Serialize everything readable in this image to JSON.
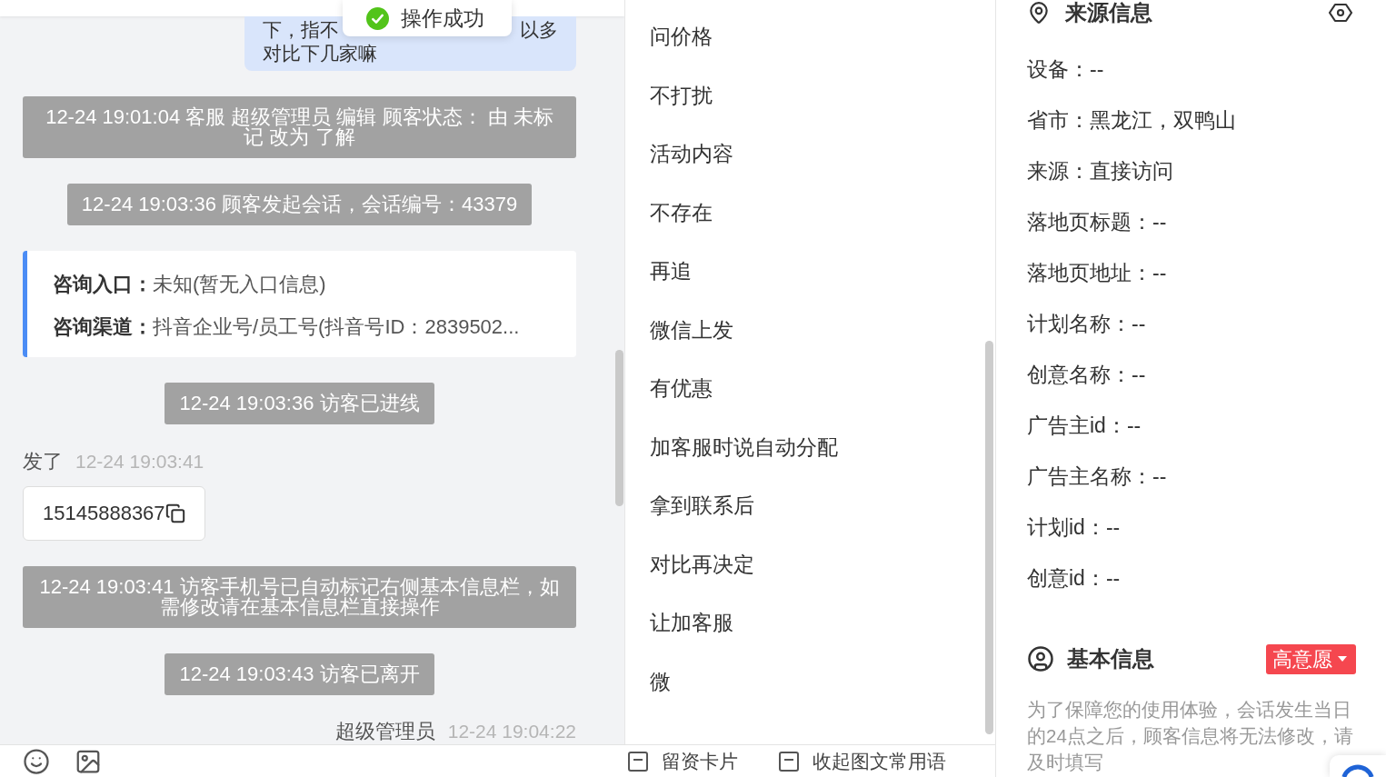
{
  "toast": {
    "text": "操作成功"
  },
  "chat": {
    "messages": [
      {
        "kind": "bubble",
        "covered_line": {
          "start": "下，指不",
          "end": "以多"
        },
        "last_line": "对比下几家嘛"
      },
      {
        "kind": "system",
        "text": "12-24 19:01:04 客服 超级管理员 编辑 顾客状态： 由 未标记 改为 了解"
      },
      {
        "kind": "system",
        "text": "12-24 19:03:36 顾客发起会话，会话编号：43379"
      },
      {
        "kind": "entry_card",
        "rows": [
          {
            "label": "咨询入口：",
            "value": "未知(暂无入口信息)"
          },
          {
            "label": "咨询渠道：",
            "value": "抖音企业号/员工号(抖音号ID：2839502..."
          }
        ]
      },
      {
        "kind": "system",
        "text": "12-24 19:03:36 访客已进线"
      },
      {
        "kind": "message",
        "sender": "发了",
        "time": "12-24 19:03:41",
        "text": "15145888367"
      },
      {
        "kind": "system",
        "text": "12-24 19:03:41 访客手机号已自动标记右侧基本信息栏，如需修改请在基本信息栏直接操作"
      },
      {
        "kind": "system",
        "text": "12-24 19:03:43 访客已离开"
      },
      {
        "kind": "sender_line",
        "sender": "超级管理员",
        "time": "12-24 19:04:22"
      }
    ]
  },
  "quick_phrases": {
    "items": [
      "问价格",
      "不打扰",
      "活动内容",
      "不存在",
      "再追",
      "微信上发",
      "有优惠",
      "加客服时说自动分配",
      "拿到联系后",
      "对比再决定",
      "让加客服",
      "微"
    ]
  },
  "toolbar": {
    "buttons": [
      "留资卡片",
      "收起图文常用语"
    ]
  },
  "source_info": {
    "title": "来源信息",
    "fields": [
      "设备：--",
      "省市：黑龙江，双鸭山",
      "来源：直接访问",
      "落地页标题：--",
      "落地页地址：--",
      "计划名称：--",
      "创意名称：--",
      "广告主id：--",
      "广告主名称：--",
      "计划id：--",
      "创意id：--"
    ]
  },
  "basic_info": {
    "title": "基本信息",
    "intent": "高意愿",
    "notice": "为了保障您的使用体验，会话发生当日的24点之后，顾客信息将无法修改，请及时填写"
  }
}
